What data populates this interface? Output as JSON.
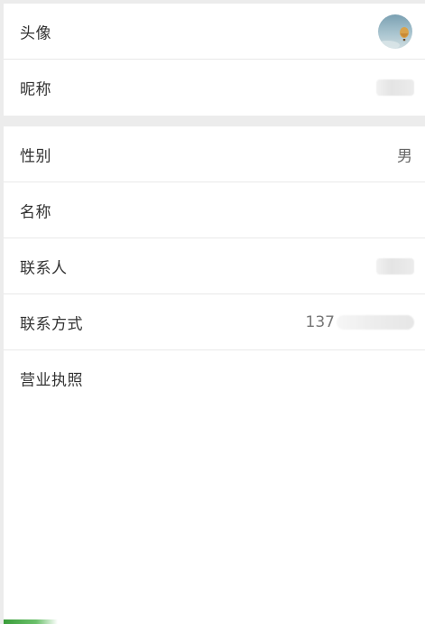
{
  "profile": {
    "avatar": {
      "label": "头像",
      "icon": "avatar-image-icon"
    },
    "nickname": {
      "label": "昵称"
    }
  },
  "details": {
    "gender": {
      "label": "性别",
      "value": "男"
    },
    "name": {
      "label": "名称"
    },
    "contact_person": {
      "label": "联系人"
    },
    "contact_method": {
      "label": "联系方式",
      "value_prefix": "137"
    },
    "business_license": {
      "label": "营业执照"
    }
  },
  "colors": {
    "background": "#ececec",
    "row_background": "#ffffff",
    "label_text": "#333333",
    "value_text": "#666666",
    "divider": "#e9e9e9"
  }
}
